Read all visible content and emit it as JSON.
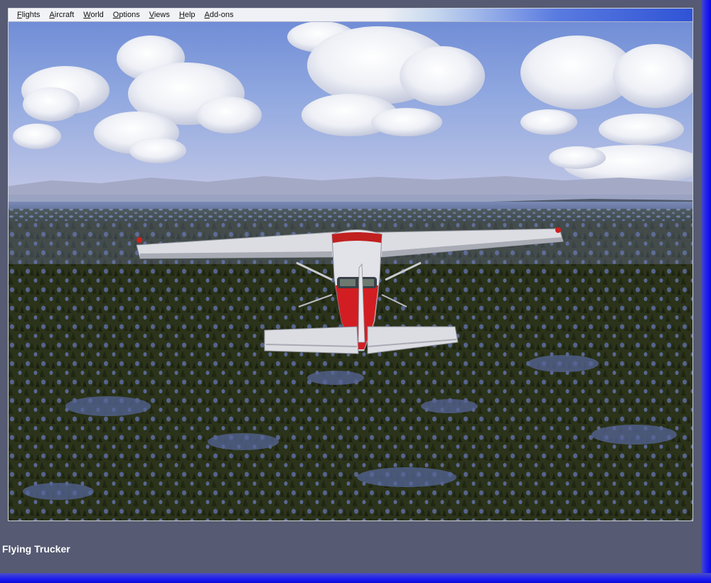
{
  "menu": {
    "items": [
      {
        "label": "Flights"
      },
      {
        "label": "Aircraft"
      },
      {
        "label": "World"
      },
      {
        "label": "Options"
      },
      {
        "label": "Views"
      },
      {
        "label": "Help"
      },
      {
        "label": "Add-ons"
      }
    ]
  },
  "caption": "Flying Trucker",
  "colors": {
    "frame": "#565a72",
    "border_glow": "#1c1cf0",
    "fuselage_red": "#d21e22",
    "wing_white": "#dcdde2",
    "forest": "#283018",
    "water": "#4c5a8e"
  }
}
